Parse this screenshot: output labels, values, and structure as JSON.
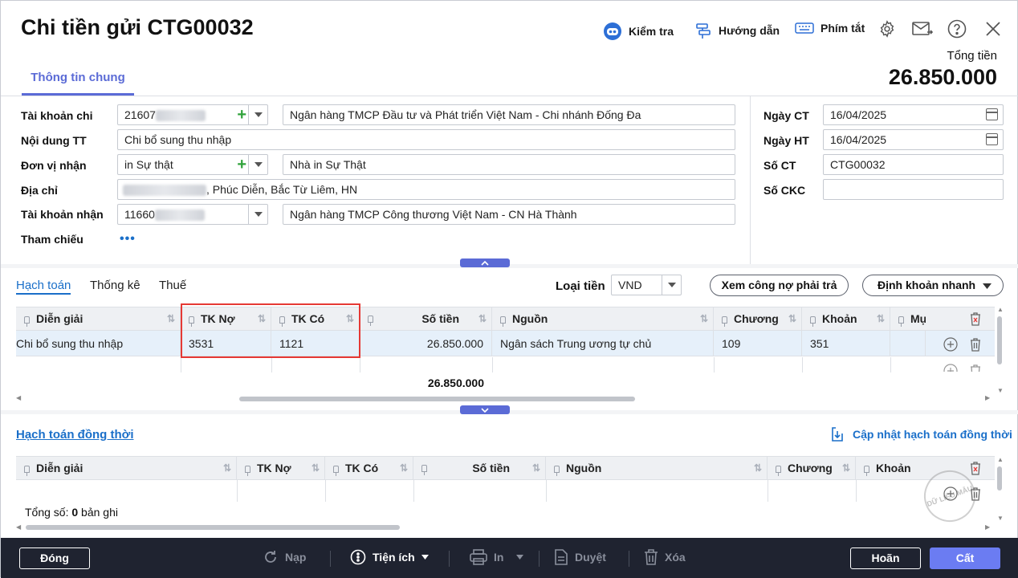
{
  "header": {
    "title": "Chi tiền gửi CTG00032",
    "toolbar": {
      "check": "Kiểm tra",
      "guide": "Hướng dẫn",
      "shortcut": "Phím tắt"
    },
    "total_label": "Tổng tiền",
    "total_value": "26.850.000",
    "tab_general": "Thông tin chung"
  },
  "form": {
    "account_label": "Tài khoản chi",
    "account_value": "21607",
    "bank_name": "Ngân hàng TMCP Đầu tư và Phát triển Việt Nam - Chi nhánh Đống Đa",
    "content_label": "Nội dung TT",
    "content_value": "Chi bổ sung thu nhập",
    "receiver_label": "Đơn vị nhận",
    "receiver_code": "in Sự thật",
    "receiver_name": "Nhà in Sự Thật",
    "address_label": "Địa chỉ",
    "address_value": ", Phúc Diễn, Bắc Từ Liêm, HN",
    "recv_account_label": "Tài khoản nhận",
    "recv_account_value": "11660",
    "recv_bank": "Ngân hàng TMCP Công thương Việt Nam - CN Hà Thành",
    "ref_label": "Tham chiếu",
    "ref_more": "•••",
    "date_ct_label": "Ngày CT",
    "date_ct": "16/04/2025",
    "date_ht_label": "Ngày HT",
    "date_ht": "16/04/2025",
    "no_ct_label": "Số CT",
    "no_ct": "CTG00032",
    "no_ckc_label": "Số CKC",
    "no_ckc": ""
  },
  "detail": {
    "tabs": [
      "Hạch toán",
      "Thống kê",
      "Thuế"
    ],
    "currency_label": "Loại tiền",
    "currency": "VND",
    "btn_debt": "Xem công nợ phải trả",
    "btn_quick": "Định khoản nhanh",
    "columns": [
      "Diễn giải",
      "TK Nợ",
      "TK Có",
      "Số tiền",
      "Nguồn",
      "Chương",
      "Khoản",
      "Mụ"
    ],
    "row": {
      "desc": "Chi bổ sung thu nhập",
      "debit": "3531",
      "credit": "1121",
      "amount": "26.850.000",
      "source": "Ngân sách Trung ương tự chủ",
      "chapter": "109",
      "item": "351"
    },
    "sum": "26.850.000"
  },
  "concurrent": {
    "title": "Hạch toán đồng thời",
    "update_btn": "Cập nhật hạch toán đồng thời",
    "columns": [
      "Diễn giải",
      "TK Nợ",
      "TK Có",
      "Số tiền",
      "Nguồn",
      "Chương",
      "Khoản"
    ],
    "total_prefix": "Tổng số: ",
    "total_count": "0",
    "total_suffix": " bản ghi",
    "watermark": "DỮ LIỆU MẪU"
  },
  "footer": {
    "close": "Đóng",
    "reload": "Nạp",
    "utility": "Tiện ích",
    "print": "In",
    "approve": "Duyệt",
    "delete": "Xóa",
    "cancel": "Hoãn",
    "save": "Cất"
  },
  "colors": {
    "accent": "#5b6bd6",
    "link": "#1a6fc9",
    "highlight": "#e53935",
    "footer": "#1f2330"
  }
}
